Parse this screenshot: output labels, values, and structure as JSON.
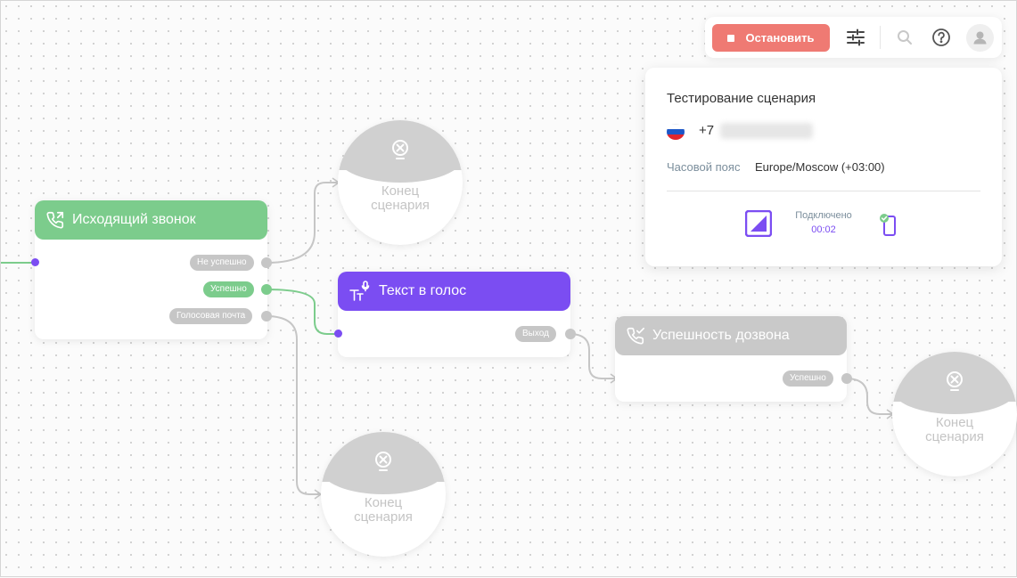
{
  "nodes": {
    "outgoing_call": {
      "title": "Исходящий звонок",
      "outputs": {
        "fail": "Не успешно",
        "success": "Успешно",
        "voicemail": "Голосовая почта"
      }
    },
    "tts": {
      "title": "Текст в голос",
      "outputs": {
        "exit": "Выход"
      }
    },
    "dial_success": {
      "title": "Успешность дозвона",
      "outputs": {
        "success": "Успешно"
      }
    },
    "end_label": "Конец\nсценария"
  },
  "toolbar": {
    "stop_label": "Остановить",
    "icons": [
      "settings-sliders-icon",
      "search-icon",
      "help-icon",
      "user-avatar-icon"
    ]
  },
  "test_panel": {
    "title": "Тестирование сценария",
    "phone_prefix": "+7",
    "timezone_label": "Часовой пояс",
    "timezone_value": "Europe/Moscow (+03:00)",
    "status_label": "Подключено",
    "status_time": "00:02"
  },
  "colors": {
    "green": "#7ccc8c",
    "purple": "#7b4df2",
    "gray": "#c9c9c9",
    "stop": "#ef7a73"
  }
}
